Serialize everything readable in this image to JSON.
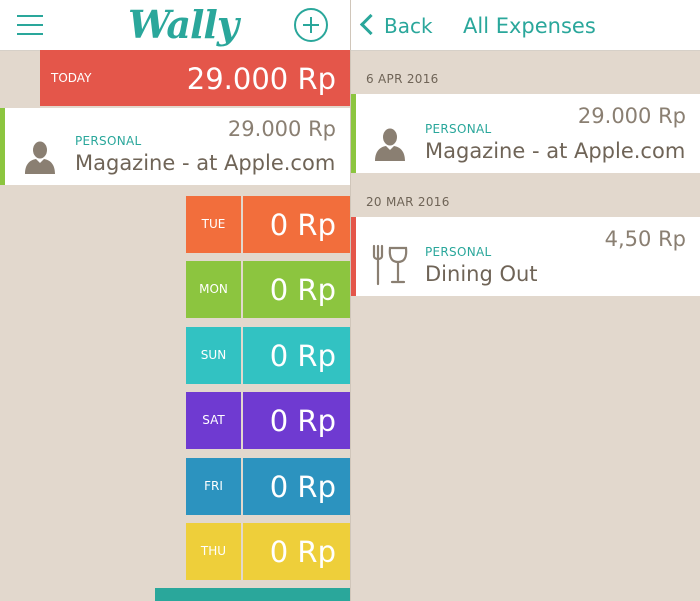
{
  "header": {
    "logo": "Wally",
    "back_label": "Back",
    "title": "All Expenses"
  },
  "today": {
    "label": "TODAY",
    "amount": "29.000 Rp"
  },
  "today_expense": {
    "category": "PERSONAL",
    "amount": "29.000 Rp",
    "description": "Magazine - at Apple.com",
    "icon": "person-icon"
  },
  "days": [
    {
      "label": "TUE",
      "amount": "0 Rp",
      "color": "#f26e3c"
    },
    {
      "label": "MON",
      "amount": "0 Rp",
      "color": "#8cc53f"
    },
    {
      "label": "SUN",
      "amount": "0 Rp",
      "color": "#32c2c2"
    },
    {
      "label": "SAT",
      "amount": "0 Rp",
      "color": "#6f3ad1"
    },
    {
      "label": "FRI",
      "amount": "0 Rp",
      "color": "#2c93bf"
    },
    {
      "label": "THU",
      "amount": "0 Rp",
      "color": "#eecf3a"
    }
  ],
  "all_expenses": [
    {
      "date": "6 APR 2016",
      "category": "PERSONAL",
      "amount": "29.000 Rp",
      "description": "Magazine - at Apple.com",
      "icon": "person-icon",
      "accent": "#8cc53f"
    },
    {
      "date": "20 MAR 2016",
      "category": "PERSONAL",
      "amount": "4,50 Rp",
      "description": "Dining Out",
      "icon": "fork-wine-glass-icon",
      "accent": "#e4564a"
    }
  ],
  "colors": {
    "brand": "#2aa79b",
    "background": "#e2d8cd",
    "today": "#e4564a"
  }
}
